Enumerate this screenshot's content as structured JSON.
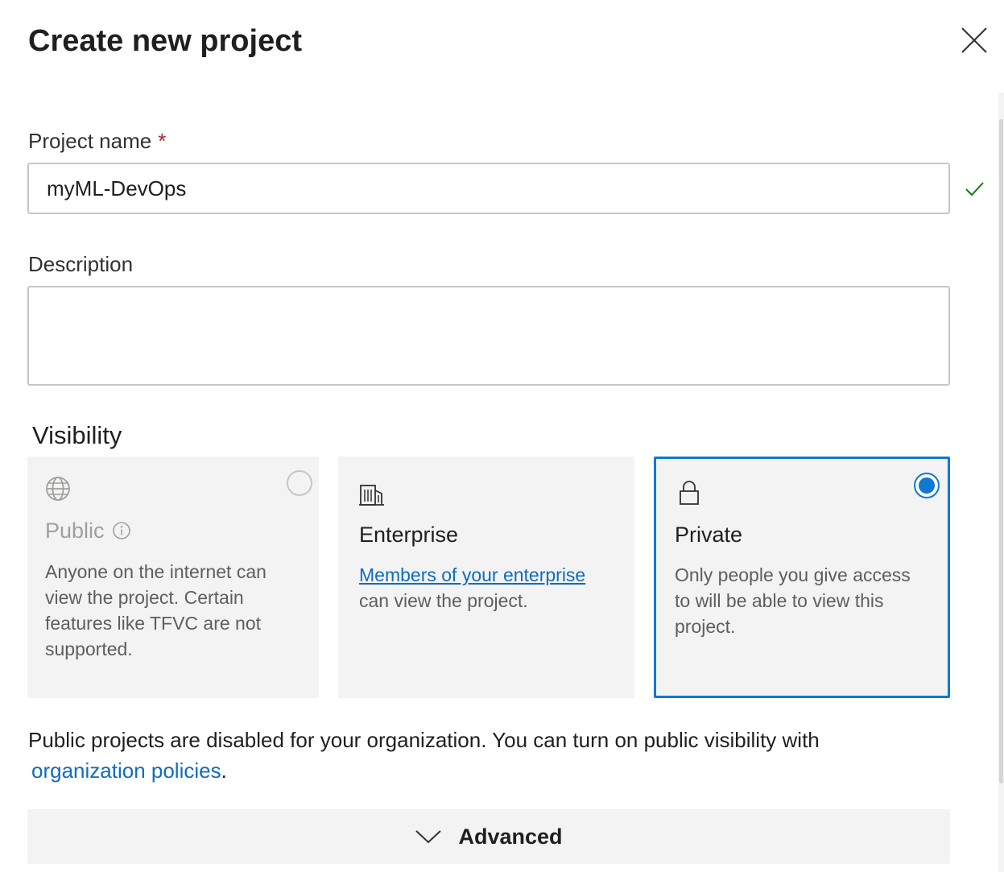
{
  "dialog": {
    "title": "Create new project",
    "close_icon": "close-icon"
  },
  "form": {
    "project_name_label": "Project name",
    "required_marker": "*",
    "project_name_value": "myML-DevOps",
    "valid_icon": "checkmark-icon",
    "description_label": "Description",
    "description_value": ""
  },
  "visibility": {
    "heading": "Visibility",
    "selected": "private",
    "options": {
      "public": {
        "icon": "globe-icon",
        "title": "Public",
        "info_icon": "info-icon",
        "description": "Anyone on the internet can view the project. Certain features like TFVC are not supported.",
        "disabled": true
      },
      "enterprise": {
        "icon": "building-icon",
        "title": "Enterprise",
        "link_text": "Members of your enterprise",
        "description_rest": " can view the project."
      },
      "private": {
        "icon": "lock-icon",
        "title": "Private",
        "description": "Only people you give access to will be able to view this project."
      }
    }
  },
  "note": {
    "text": "Public projects are disabled for your organization. You can turn on public visibility with",
    "link_text": "organization policies",
    "suffix": "."
  },
  "advanced": {
    "icon": "chevron-down-icon",
    "label": "Advanced"
  },
  "colors": {
    "accent": "#0f78d4",
    "link": "#0f6cbd",
    "required": "#a4262c",
    "success": "#107c10",
    "card_background": "#f3f3f3"
  }
}
